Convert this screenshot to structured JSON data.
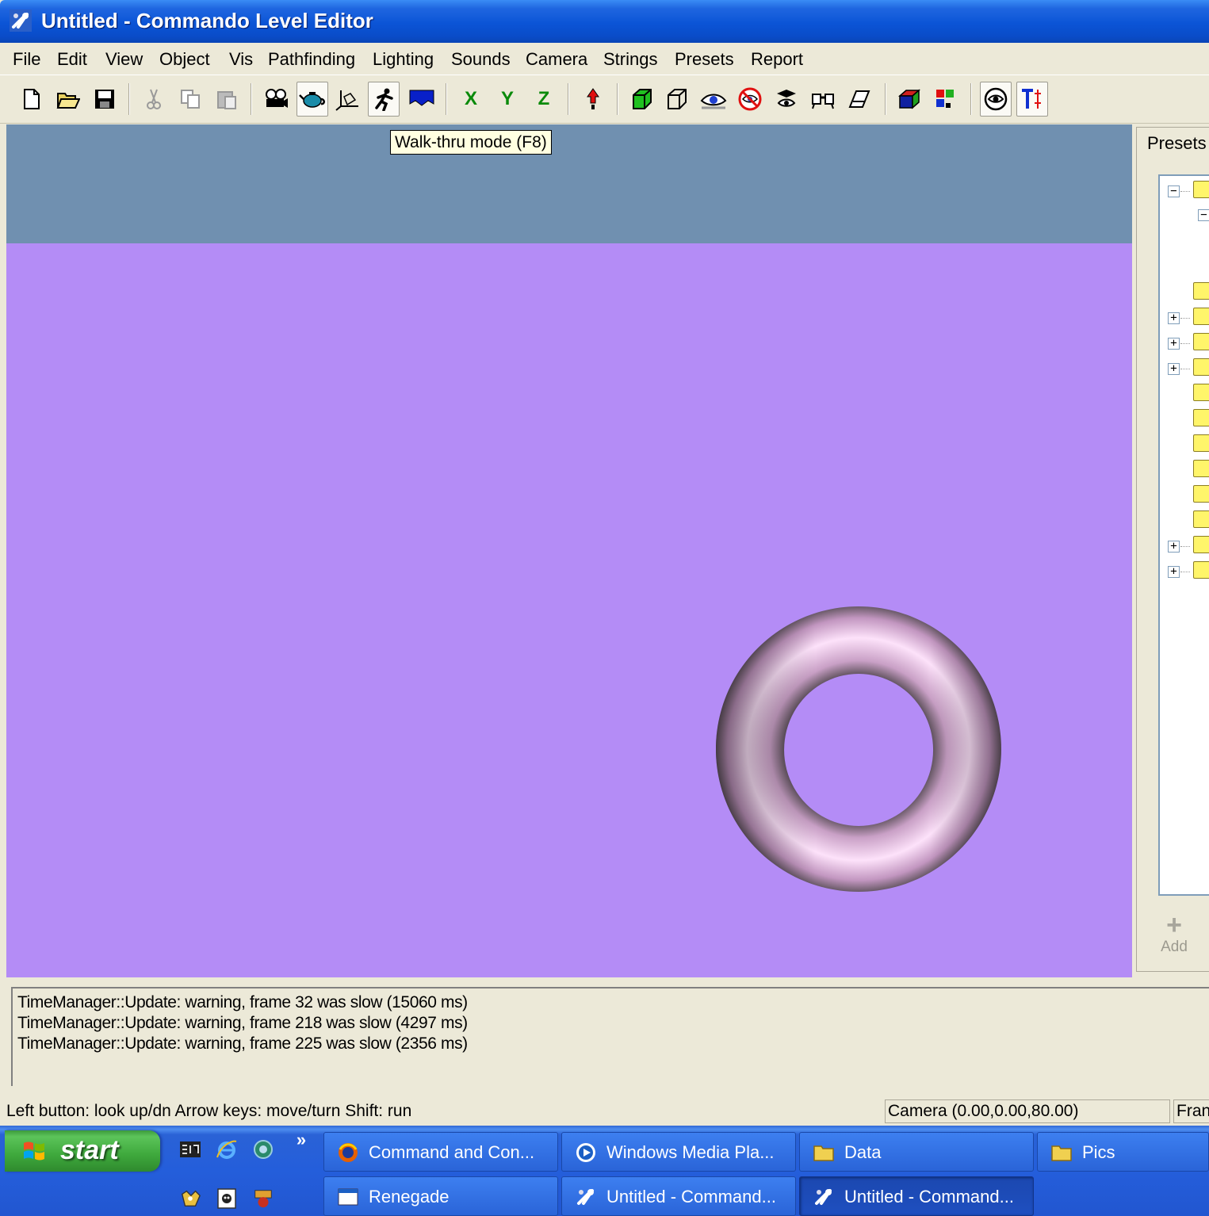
{
  "window": {
    "title": "Untitled - Commando Level Editor"
  },
  "menu": [
    "File",
    "Edit",
    "View",
    "Object",
    "Vis",
    "Pathfinding",
    "Lighting",
    "Sounds",
    "Camera",
    "Strings",
    "Presets",
    "Report"
  ],
  "toolbar": {
    "axis_x": "X",
    "axis_y": "Y",
    "axis_z": "Z",
    "tooltip": "Walk-thru mode (F8)"
  },
  "presets": {
    "label": "Presets",
    "add_label": "Add"
  },
  "output": {
    "lines": [
      "TimeManager::Update: warning, frame 32 was slow (15060 ms)",
      "TimeManager::Update: warning, frame 218 was slow (4297 ms)",
      "TimeManager::Update: warning, frame 225 was slow (2356 ms)"
    ]
  },
  "status": {
    "hint": "Left button: look up/dn Arrow keys: move/turn Shift: run",
    "camera": "Camera (0.00,0.00,80.00)",
    "frame": "Fran"
  },
  "taskbar": {
    "start": "start",
    "quicklaunch_more": "»",
    "tasks": [
      "Command and Con...",
      "Windows Media Pla...",
      "Data",
      "Pics",
      "Renegade",
      "Untitled - Command...",
      "Untitled - Command..."
    ]
  },
  "colors": {
    "viewport_background": "#b48cf6",
    "sky": "#7090b0",
    "torus": "#f3c6ee"
  }
}
